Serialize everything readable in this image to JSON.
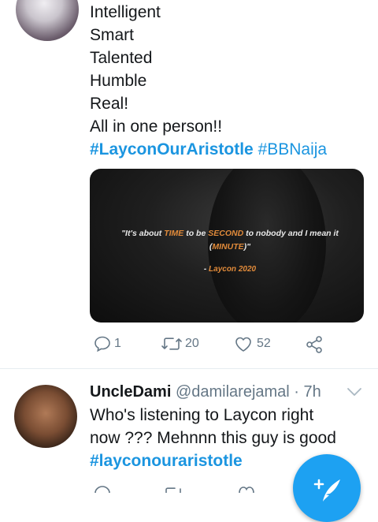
{
  "tweet1": {
    "lines": [
      "Intelligent",
      "Smart",
      "Talented",
      "Humble",
      "Real!",
      "All in one person!!"
    ],
    "hashtag_1": "#LayconOurAristotle",
    "hashtag_2": "#BBNaija",
    "media": {
      "quote_part1": "\"It's about ",
      "quote_time": "TIME",
      "quote_part2": " to be ",
      "quote_second": "SECOND",
      "quote_part3": " to nobody and I mean it (",
      "quote_minute": "MINUTE",
      "quote_part4": ")\"",
      "credit_prefix": "- ",
      "credit_name": "Laycon 2020"
    },
    "actions": {
      "replies": "1",
      "retweets": "20",
      "likes": "52"
    }
  },
  "tweet2": {
    "name": "UncleDami",
    "handle": "@damilarejamal",
    "time": "· 7h",
    "line1": "Who's listening to Laycon right",
    "line2": "now ??? Mehnnn this guy is good",
    "hashtag": "#layconouraristotle"
  },
  "colors": {
    "accent": "#1da1f2",
    "link": "#1b95e0",
    "muted": "#657786",
    "highlight": "#e08a3a"
  },
  "icons": [
    "reply-icon",
    "retweet-icon",
    "like-icon",
    "share-icon",
    "chevron-down-icon",
    "compose-tweet-icon"
  ]
}
